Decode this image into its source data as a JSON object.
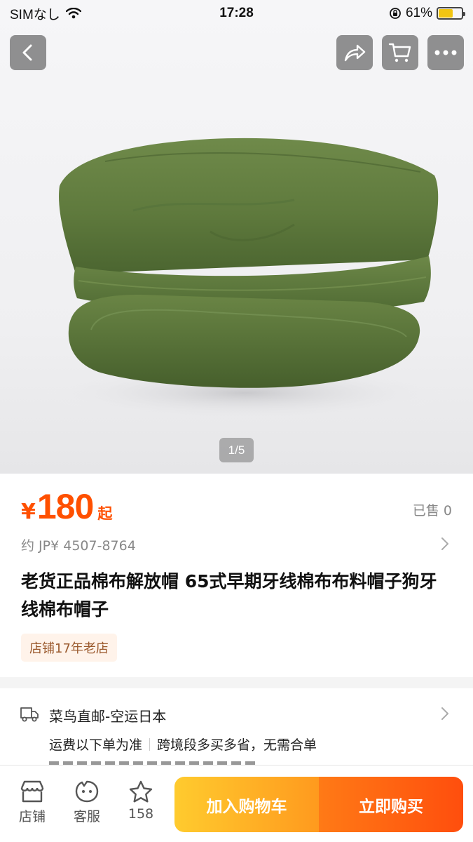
{
  "status_bar": {
    "carrier": "SIMなし",
    "time": "17:28",
    "battery": "61%",
    "battery_level": 0.61
  },
  "hero": {
    "page_indicator": "1/5"
  },
  "icons": {
    "back": "back-icon",
    "share": "share-icon",
    "cart": "cart-icon",
    "more": "more-icon"
  },
  "product": {
    "price_symbol": "¥",
    "price": "180",
    "price_suffix": "起",
    "sold": "已售 0",
    "approx_price": "约 JP¥ 4507-8764",
    "title": "老货正品棉布解放帽 65式早期牙线棉布布料帽子狗牙线棉布帽子",
    "store_badge": "店铺17年老店"
  },
  "shipping": {
    "title": "菜鸟直邮-空运日本",
    "fee_note": "运费以下单为准",
    "cross_border": "跨境段多买多省，无需合单"
  },
  "bottom_bar": {
    "store_label": "店铺",
    "service_label": "客服",
    "favorites_count": "158",
    "add_to_cart": "加入购物车",
    "buy_now": "立即购买"
  },
  "colors": {
    "accent": "#ff5000",
    "cart_button": "#ffb023",
    "buy_button": "#ff5a10",
    "hat": "#5e7a3d"
  }
}
